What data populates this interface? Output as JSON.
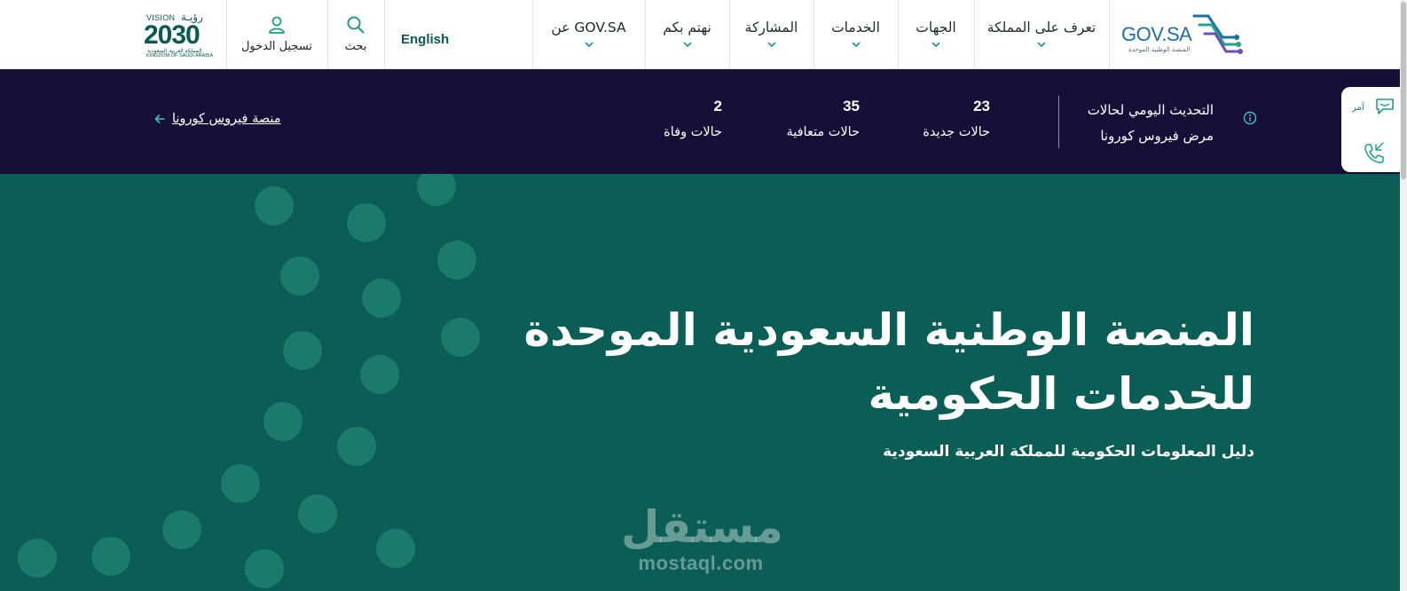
{
  "header": {
    "logo": {
      "text": "GOV.SA",
      "subtitle": "المنصة الوطنية الموحدة"
    },
    "nav": [
      {
        "label": "تعرف على المملكة"
      },
      {
        "label": "الجهات"
      },
      {
        "label": "الخدمات"
      },
      {
        "label": "المشاركة"
      },
      {
        "label": "نهتم بكم"
      },
      {
        "label": "عن GOV.SA"
      }
    ],
    "language": "English",
    "search_label": "بحث",
    "login_label": "تسجيل الدخول",
    "vision": {
      "top": "VISION",
      "top_ar": "رؤيـة",
      "year": "2030",
      "line_ar": "المملكة العربية السعودية",
      "line_en": "KINGDOM OF SAUDI ARABIA"
    }
  },
  "covid_bar": {
    "title_line1": "التحديث اليومي لحالات",
    "title_line2": "مرض فيروس كورونا",
    "stats": [
      {
        "value": "23",
        "label": "حالات جديدة"
      },
      {
        "value": "35",
        "label": "حالات متعافية"
      },
      {
        "value": "2",
        "label": "حالات وفاة"
      }
    ],
    "platform_link": "منصة فيروس كورونا"
  },
  "side_widget": {
    "label": "آمر"
  },
  "hero": {
    "title_line1": "المنصة الوطنية السعودية الموحدة",
    "title_line2": "للخدمات الحكومية",
    "subtitle": "دليل المعلومات الحكومية للمملكة العربية السعودية"
  },
  "watermark": {
    "arabic": "مستقل",
    "latin": "mostaql.com"
  },
  "colors": {
    "header_bg": "#ffffff",
    "covid_bg": "#161039",
    "hero_bg": "#0a5e55",
    "dot": "#1c7a6c",
    "accent": "#1d9e8a",
    "logo_blue": "#1b6fa8"
  }
}
